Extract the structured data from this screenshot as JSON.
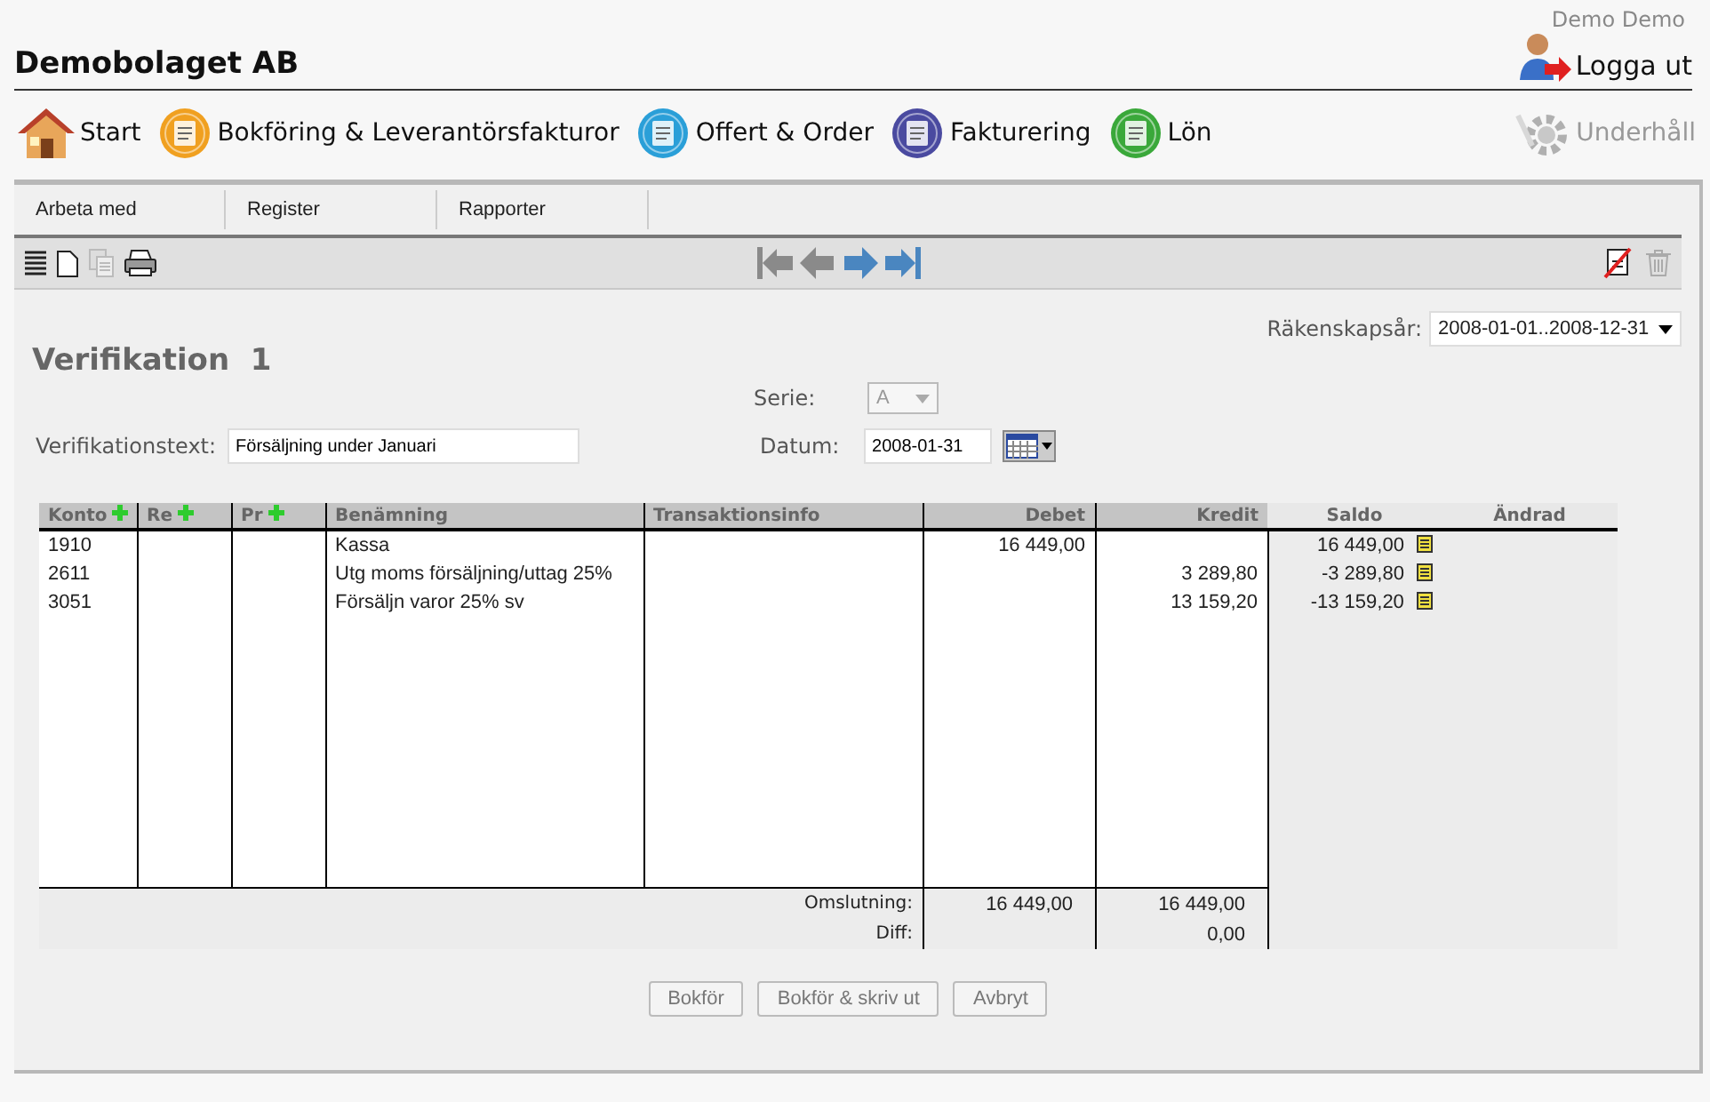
{
  "user": "Demo Demo",
  "company": "Demobolaget AB",
  "logout": "Logga ut",
  "nav": [
    {
      "label": "Start",
      "kind": "house",
      "disabled": false
    },
    {
      "label": "Bokföring & Leverantörsfakturor",
      "kind": "ledger",
      "disabled": false
    },
    {
      "label": "Offert & Order",
      "kind": "order",
      "disabled": false
    },
    {
      "label": "Fakturering",
      "kind": "invoice",
      "disabled": false
    },
    {
      "label": "Lön",
      "kind": "salary",
      "disabled": false
    },
    {
      "label": "Underhåll",
      "kind": "gear",
      "disabled": true
    }
  ],
  "menu": [
    "Arbeta med",
    "Register",
    "Rapporter"
  ],
  "toolbar": {
    "left": [
      {
        "kind": "list",
        "disabled": false
      },
      {
        "kind": "new",
        "disabled": false
      },
      {
        "kind": "copy",
        "disabled": true
      },
      {
        "kind": "print",
        "disabled": false
      }
    ],
    "nav": [
      {
        "kind": "first",
        "disabled": true
      },
      {
        "kind": "prev",
        "disabled": true
      },
      {
        "kind": "next",
        "disabled": false
      },
      {
        "kind": "last",
        "disabled": false
      }
    ],
    "right": [
      {
        "kind": "noedit",
        "disabled": false
      },
      {
        "kind": "trash",
        "disabled": true
      }
    ]
  },
  "title": "Verifikation",
  "number": "1",
  "fiscal_year": {
    "label": "Räkenskapsår:",
    "value": "2008-01-01..2008-12-31"
  },
  "series": {
    "label": "Serie:",
    "value": "A",
    "disabled": true
  },
  "text_field": {
    "label": "Verifikationstext:",
    "value": "Försäljning under Januari"
  },
  "date": {
    "label": "Datum:",
    "value": "2008-01-31"
  },
  "table": {
    "columns": [
      {
        "label": "Konto",
        "add": true
      },
      {
        "label": "Re",
        "add": true
      },
      {
        "label": "Pr",
        "add": true
      },
      {
        "label": "Benämning",
        "add": false
      },
      {
        "label": "Transaktionsinfo",
        "add": false
      },
      {
        "label": "Debet",
        "add": false
      },
      {
        "label": "Kredit",
        "add": false
      },
      {
        "label": "Saldo",
        "add": false
      },
      {
        "label": "Ändrad",
        "add": false
      }
    ],
    "rows": [
      {
        "konto": "1910",
        "benamning": "Kassa",
        "debet": "16 449,00",
        "saldo": "16 449,00"
      },
      {
        "konto": "2611",
        "benamning": "Utg moms försäljning/uttag 25%",
        "kredit": "3 289,80",
        "saldo": "-3 289,80"
      },
      {
        "konto": "3051",
        "benamning": "Försäljn varor 25% sv",
        "kredit": "13 159,20",
        "saldo": "-13 159,20"
      }
    ],
    "totals": [
      {
        "label": "Omslutning:",
        "debet": "16 449,00",
        "kredit": "16 449,00"
      },
      {
        "label": "Diff:",
        "kredit": "0,00"
      }
    ]
  },
  "buttons": [
    {
      "label": "Bokför",
      "disabled": true
    },
    {
      "label": "Bokför & skriv ut",
      "disabled": true
    },
    {
      "label": "Avbryt",
      "disabled": true
    }
  ]
}
